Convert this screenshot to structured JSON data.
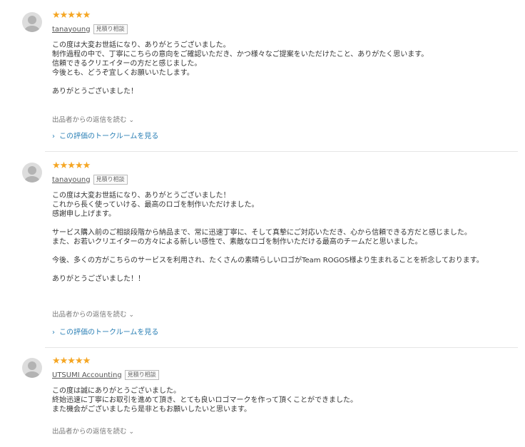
{
  "reviews": [
    {
      "stars": "★★★★★",
      "username": "tanayoung",
      "badge": "見積り相談",
      "lines": [
        "この度は大変お世話になり、ありがとうございました。",
        "制作過程の中で、丁寧にこちらの意向をご確認いただき、かつ様々なご提案をいただけたこと、ありがたく思います。",
        "信頼できるクリエイターの方だと感じました。",
        "今後とも、どうぞ宜しくお願いいたします。",
        "ありがとうございました！"
      ],
      "reply_toggle": "出品者からの返信を読む",
      "talk_link": "この評価のトークルームを見る"
    },
    {
      "stars": "★★★★★",
      "username": "tanayoung",
      "badge": "見積り相談",
      "lines": [
        "この度は大変お世話になり、ありがとうございました！",
        "これから長く使っていける、最高のロゴを制作いただけました。",
        "感謝申し上げます。",
        "サービス購入前のご相談段階から納品まで、常に迅速丁寧に、そして真摯にご対応いただき、心から信頼できる方だと感じました。",
        "また、お若いクリエイターの方々による新しい感性で、素敵なロゴを制作いただける最高のチームだと思いました。",
        "今後、多くの方がこちらのサービスを利用され、たくさんの素晴らしいロゴがTeam ROGOS様より生まれることを祈念しております。",
        "ありがとうございました！！"
      ],
      "reply_toggle": "出品者からの返信を読む",
      "talk_link": "この評価のトークルームを見る"
    },
    {
      "stars": "★★★★★",
      "username": "UTSUMI Accounting",
      "badge": "見積り相談",
      "lines": [
        "この度は誠にありがとうございました。",
        "終始迅速に丁寧にお取引を進めて頂き、とても良いロゴマークを作って頂くことができました。",
        "また機会がございましたら是非ともお願いしたいと思います。"
      ],
      "reply_toggle": "出品者からの返信を読む"
    }
  ],
  "colors": {
    "star": "#f5a623",
    "link": "#2a7fb5",
    "divider": "#e6e6e6"
  },
  "icons": {
    "avatar": "default-user-avatar-icon",
    "chevron": "chevron-down-icon",
    "arrow": "chevron-right-icon"
  }
}
